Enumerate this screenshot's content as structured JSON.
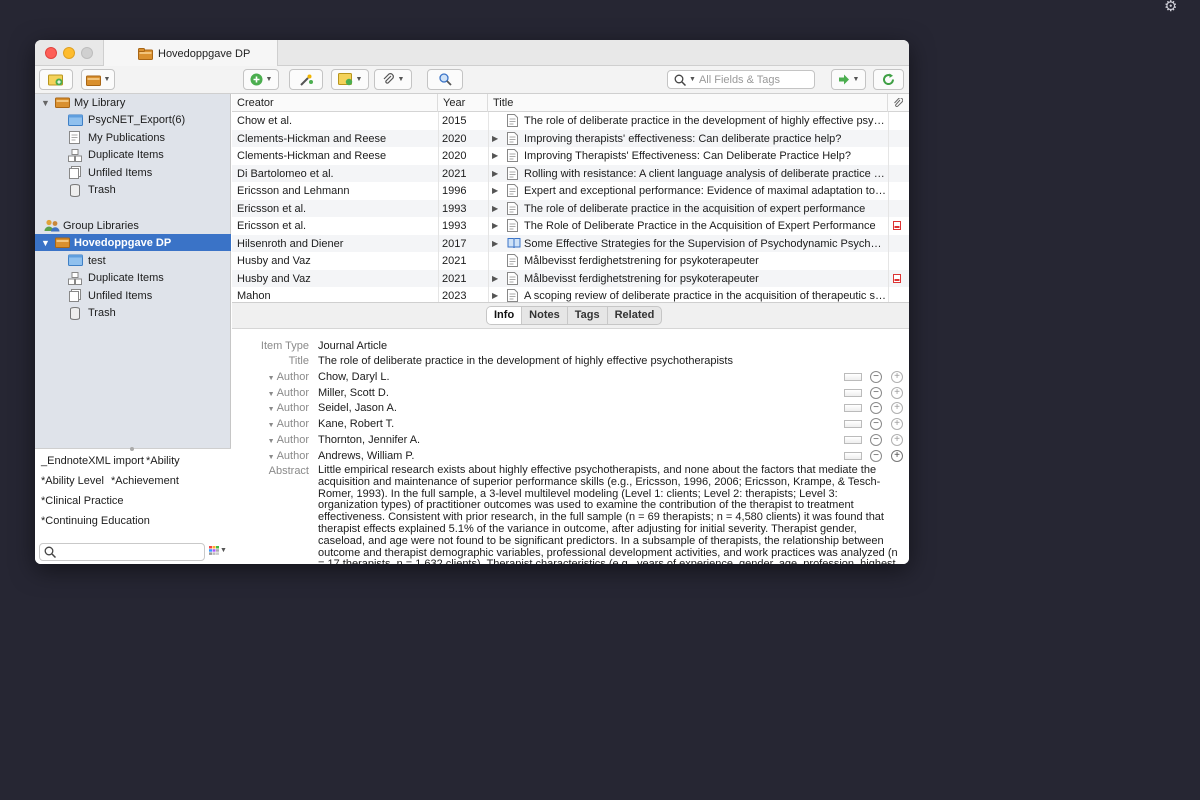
{
  "tab_title": "Hovedoppgave DP",
  "search": {
    "placeholder": "All Fields & Tags"
  },
  "sidebar": {
    "library": [
      {
        "label": "My Library",
        "level": 0
      },
      {
        "label": "PsycNET_Export(6)",
        "level": 1
      },
      {
        "label": "My Publications",
        "level": 1
      },
      {
        "label": "Duplicate Items",
        "level": 1
      },
      {
        "label": "Unfiled Items",
        "level": 1
      },
      {
        "label": "Trash",
        "level": 1
      }
    ],
    "group_header": "Group Libraries",
    "group": [
      {
        "label": "Hovedoppgave DP",
        "level": 0
      },
      {
        "label": "test",
        "level": 1
      },
      {
        "label": "Duplicate Items",
        "level": 1
      },
      {
        "label": "Unfiled Items",
        "level": 1
      },
      {
        "label": "Trash",
        "level": 1
      }
    ]
  },
  "tags": [
    "_EndnoteXML import",
    "*Ability",
    "*Ability Level",
    "*Achievement",
    "*Clinical Practice",
    "*Continuing Education"
  ],
  "columns": {
    "creator": "Creator",
    "year": "Year",
    "title": "Title"
  },
  "items": [
    {
      "creator": "Chow et al.",
      "year": "2015",
      "title": "The role of deliberate practice in the development of highly effective psych…",
      "expand": false,
      "type": "doc",
      "pdf": false
    },
    {
      "creator": "Clements-Hickman and Reese",
      "year": "2020",
      "title": "Improving therapists' effectiveness: Can deliberate practice help?",
      "expand": true,
      "type": "doc",
      "pdf": false
    },
    {
      "creator": "Clements-Hickman and Reese",
      "year": "2020",
      "title": "Improving Therapists' Effectiveness: Can Deliberate Practice Help?",
      "expand": true,
      "type": "doc",
      "pdf": false
    },
    {
      "creator": "Di Bartolomeo et al.",
      "year": "2021",
      "title": "Rolling with resistance: A client language analysis of deliberate practice in …",
      "expand": true,
      "type": "doc",
      "pdf": false
    },
    {
      "creator": "Ericsson and Lehmann",
      "year": "1996",
      "title": "Expert and exceptional performance: Evidence of maximal adaptation to ta…",
      "expand": true,
      "type": "doc",
      "pdf": false
    },
    {
      "creator": "Ericsson et al.",
      "year": "1993",
      "title": "The role of deliberate practice in the acquisition of expert performance",
      "expand": true,
      "type": "doc",
      "pdf": false
    },
    {
      "creator": "Ericsson et al.",
      "year": "1993",
      "title": "The Role of Deliberate Practice in the Acquisition of Expert Performance",
      "expand": true,
      "type": "doc",
      "pdf": true
    },
    {
      "creator": "Hilsenroth and Diener",
      "year": "2017",
      "title": "Some Effective Strategies for the Supervision of Psychodynamic Psychother…",
      "expand": true,
      "type": "book",
      "pdf": false
    },
    {
      "creator": "Husby and Vaz",
      "year": "2021",
      "title": "Målbevisst ferdighetstrening for psykoterapeuter",
      "expand": false,
      "type": "doc",
      "pdf": false
    },
    {
      "creator": "Husby and Vaz",
      "year": "2021",
      "title": "Målbevisst ferdighetstrening for psykoterapeuter",
      "expand": true,
      "type": "doc",
      "pdf": true
    },
    {
      "creator": "Mahon",
      "year": "2023",
      "title": "A scoping review of deliberate practice in the acquisition of therapeutic ski…",
      "expand": true,
      "type": "doc",
      "pdf": false
    }
  ],
  "detail": {
    "tabs": [
      "Info",
      "Notes",
      "Tags",
      "Related"
    ],
    "active_tab": "Info",
    "item_type_label": "Item Type",
    "item_type": "Journal Article",
    "title_label": "Title",
    "title": "The role of deliberate practice in the development of highly effective psychotherapists",
    "author_label": "Author",
    "authors": [
      "Chow, Daryl L.",
      "Miller, Scott D.",
      "Seidel, Jason A.",
      "Kane, Robert T.",
      "Thornton, Jennifer A.",
      "Andrews, William P."
    ],
    "abstract_label": "Abstract",
    "abstract": "Little empirical research exists about highly effective psychotherapists, and none about the factors that mediate the acquisition and maintenance of superior performance skills (e.g., Ericsson, 1996, 2006; Ericsson, Krampe, & Tesch-Romer, 1993). In the full sample, a 3-level multilevel modeling (Level 1: clients; Level 2: therapists; Level 3: organization types) of practitioner outcomes was used to examine the contribution of the therapist to treatment effectiveness. Consistent with prior research, in the full sample (n = 69 therapists; n = 4,580 clients) it was found that therapist effects explained 5.1% of the variance in outcome, after adjusting for initial severity. Therapist gender, caseload, and age were not found to be significant predictors. In a subsample of therapists, the relationship between outcome and therapist demographic variables, professional development activities, and work practices was analyzed (n = 17 therapists, n = 1,632 clients). Therapist characteristics (e.g., years of experience, gender, age, profession, highest qualification, caseload, degree of theoretical"
  },
  "colors": {
    "selection": "#3a73c7",
    "sidebar_bg": "#dfe3ea",
    "desktop": "#262633"
  }
}
